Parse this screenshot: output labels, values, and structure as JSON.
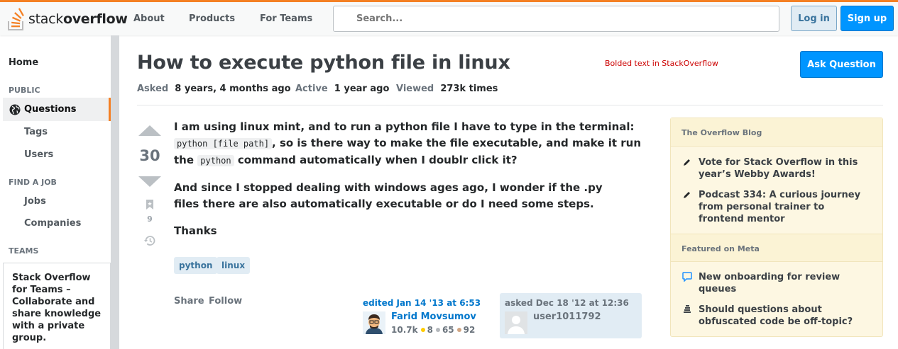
{
  "header": {
    "logo_light": "stack",
    "logo_bold": "overflow",
    "nav": [
      "About",
      "Products",
      "For Teams"
    ],
    "search_placeholder": "Search...",
    "login": "Log in",
    "signup": "Sign up"
  },
  "sidebar": {
    "home": "Home",
    "public_heading": "PUBLIC",
    "questions": "Questions",
    "tags": "Tags",
    "users": "Users",
    "find_job_heading": "FIND A JOB",
    "jobs": "Jobs",
    "companies": "Companies",
    "teams_heading": "TEAMS",
    "teams_title": "Stack Overflow for Teams",
    "teams_text": "– Collaborate and share knowledge with a private group."
  },
  "question": {
    "title": "How to execute python file in linux",
    "annotation": "Bolded text in StackOverflow",
    "ask_button": "Ask Question",
    "asked_label": "Asked",
    "asked_value": "8 years, 4 months ago",
    "active_label": "Active",
    "active_value": "1 year ago",
    "viewed_label": "Viewed",
    "viewed_value": "273k times",
    "votes": "30",
    "bookmarks": "9",
    "body_p1_a": "I am using linux mint, and to run a python file I have to type in the terminal:",
    "body_code1": "python [file path]",
    "body_p1_b": ", so is there way to make the file executable, and make it run",
    "body_p1_c": "the",
    "body_code2": "python",
    "body_p1_d": "command automatically when I doublr click it?",
    "body_p2": "And since I stopped dealing with windows ages ago, I wonder if the .py files there are also automatically executable or do I need some steps.",
    "body_p3": "Thanks",
    "tags": [
      "python",
      "linux"
    ],
    "share": "Share",
    "follow": "Follow",
    "edited": "edited Jan 14 '13 at 6:53",
    "editor_name": "Farid Movsumov",
    "editor_rep": "10.7k",
    "editor_gold": "8",
    "editor_silver": "65",
    "editor_bronze": "92",
    "asked_card": "asked Dec 18 '12 at 12:36",
    "asker_name": "user1011792"
  },
  "blog": {
    "heading": "The Overflow Blog",
    "items": [
      "Vote for Stack Overflow in this year’s Webby Awards!",
      "Podcast 334: A curious journey from personal trainer to frontend mentor"
    ],
    "meta_heading": "Featured on Meta",
    "meta_items": [
      "New onboarding for review queues",
      "Should questions about obfuscated code be off-topic?"
    ]
  },
  "colors": {
    "accent": "#f48024",
    "primary_button": "#0095ff",
    "link": "#0077cc",
    "gold": "#ffcc01",
    "silver": "#b4b8bc",
    "bronze": "#d1a684"
  }
}
